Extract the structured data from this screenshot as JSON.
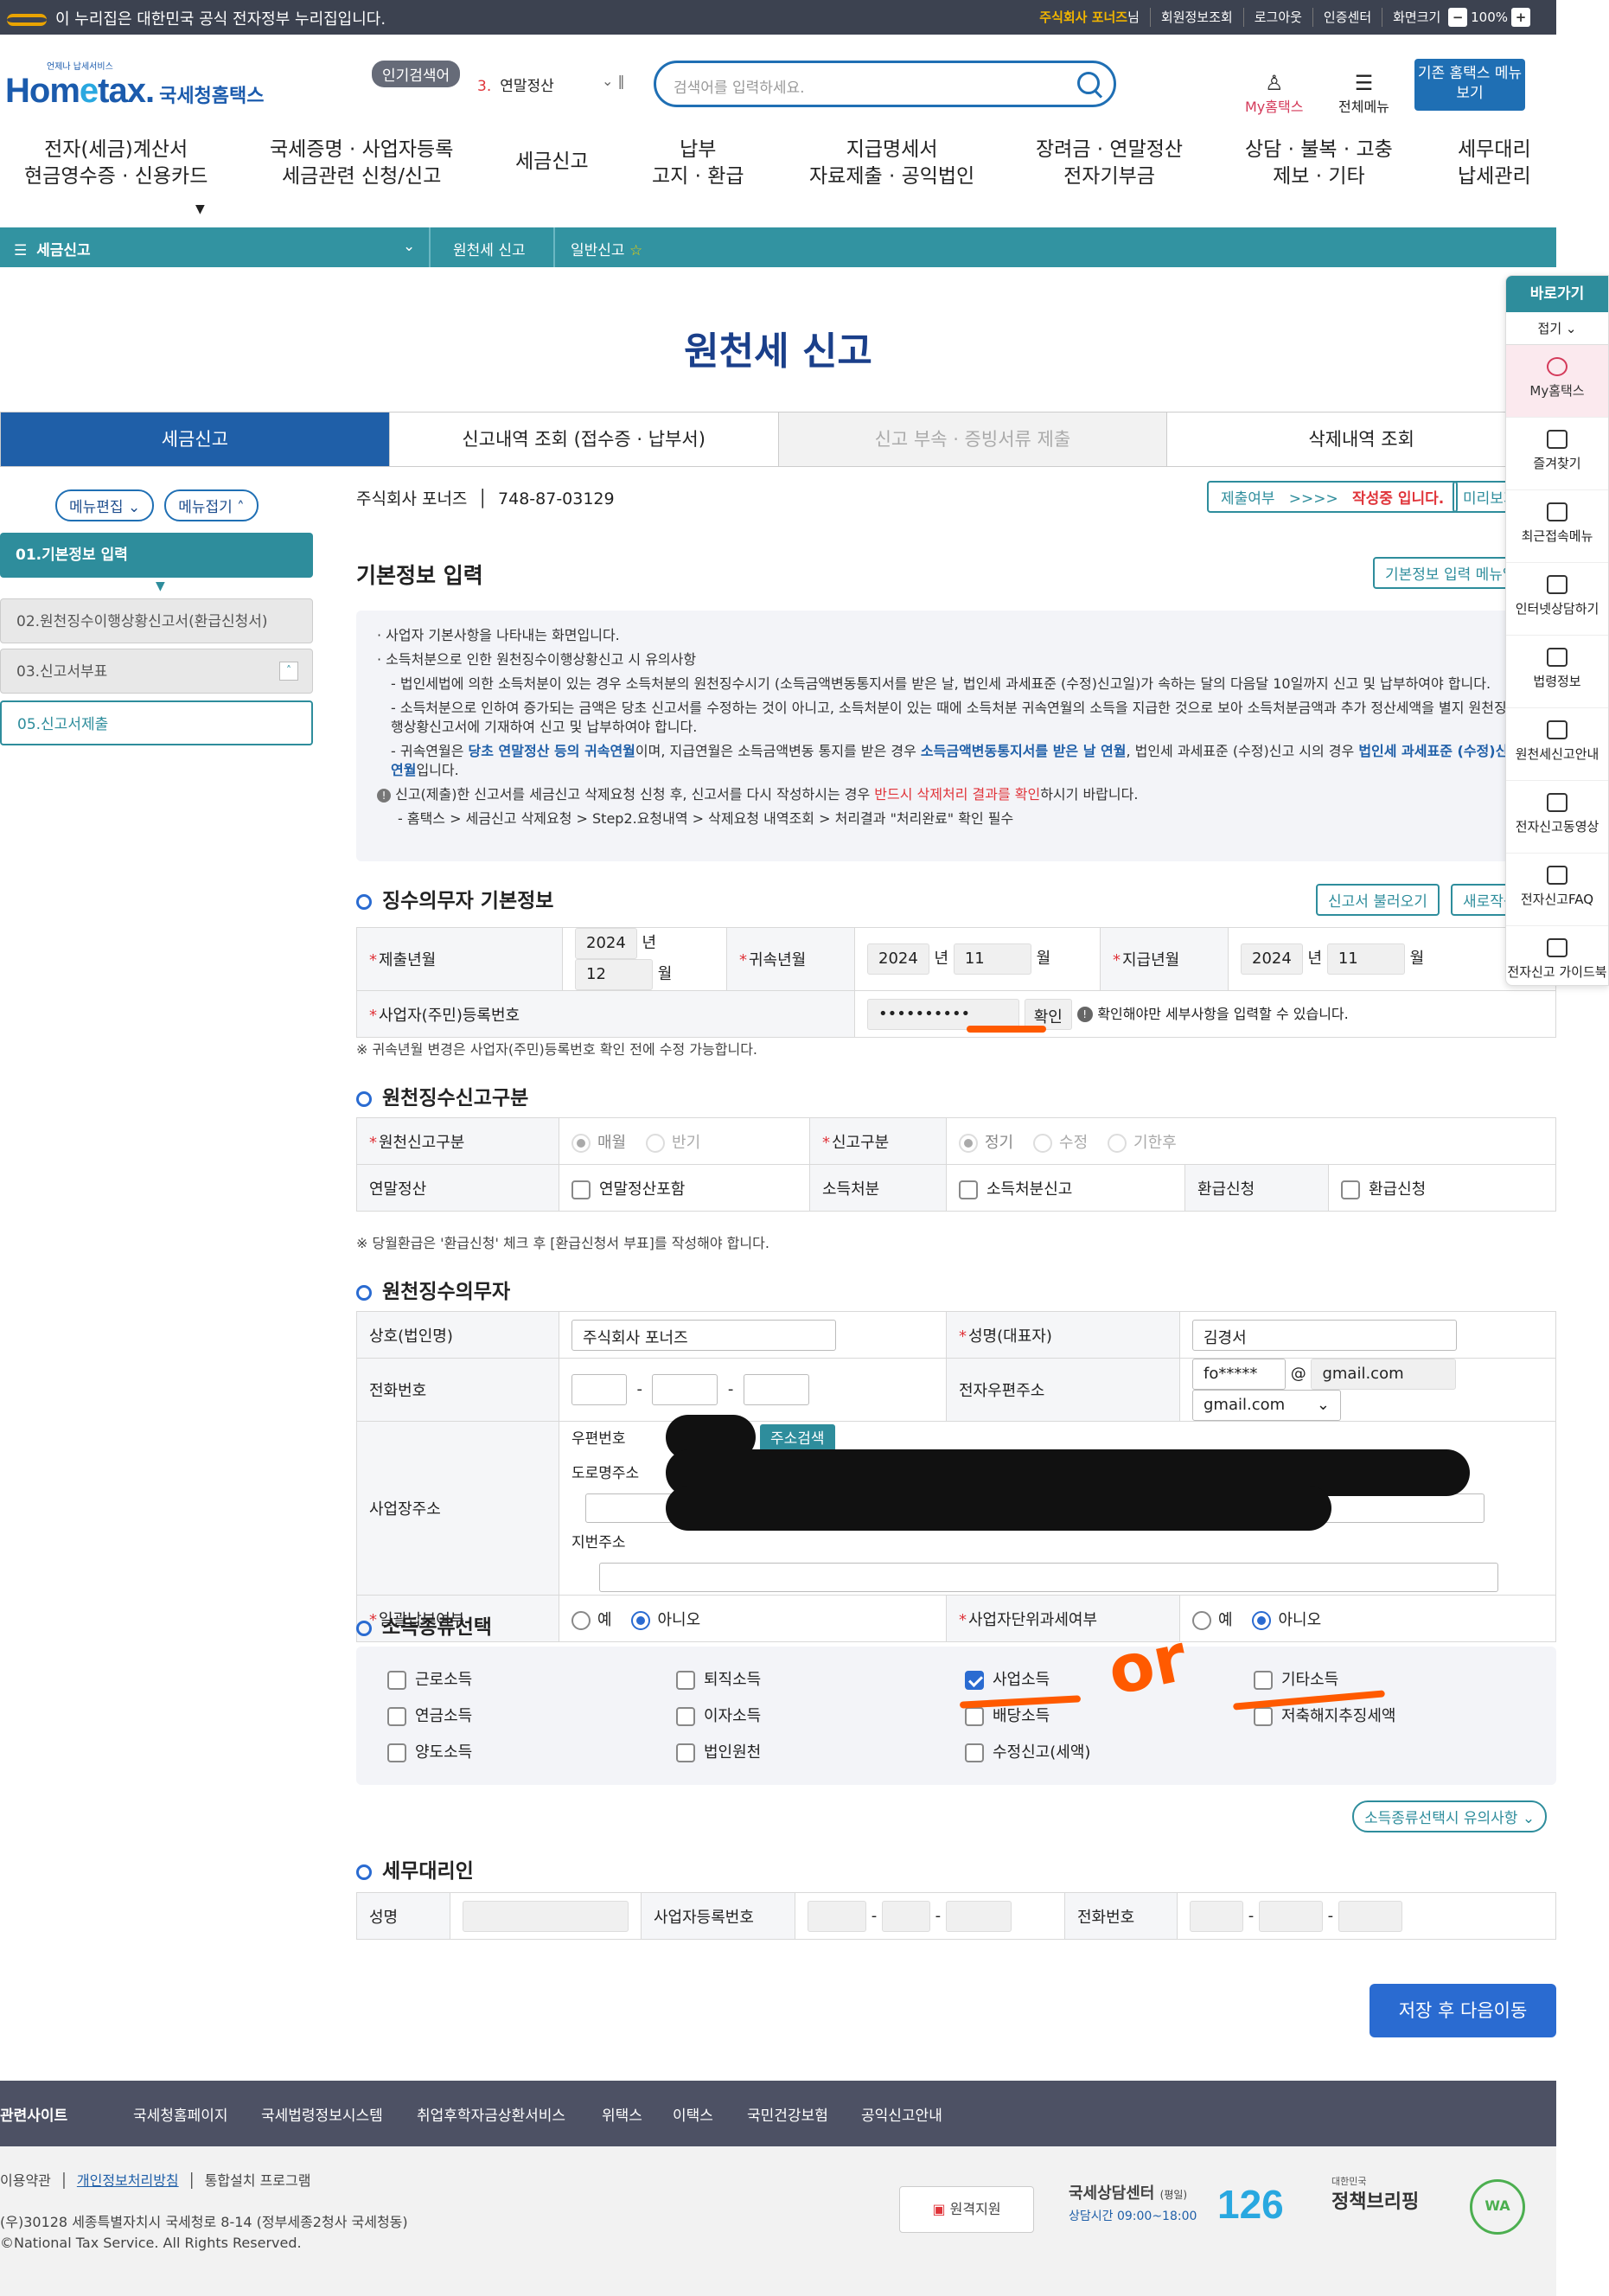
{
  "topbar": {
    "gov_notice": "이 누리집은 대한민국 공식 전자정부 누리집입니다.",
    "company": "주식회사 포너즈",
    "company_suffix": "님",
    "links": [
      "회원정보조회",
      "로그아웃",
      "인증센터",
      "화면크기"
    ],
    "zoom": "100%"
  },
  "header": {
    "logo_main": "Hom",
    "logo_e": "e",
    "logo_tax": "tax.",
    "logo_name": "국세청홈택스",
    "logo_tag": "언제나 납세서비스",
    "popular_label": "인기검색어",
    "popular_num": "3.",
    "popular_text": "연말정산",
    "search_placeholder": "검색어를 입력하세요.",
    "my_hometax": "My홈택스",
    "all_menu": "전체메뉴",
    "old_hometax": "기존 홈택스 메뉴 보기"
  },
  "gnb": [
    {
      "l1": "전자(세금)계산서",
      "l2": "현금영수증 · 신용카드"
    },
    {
      "l1": "국세증명 · 사업자등록",
      "l2": "세금관련 신청/신고"
    },
    {
      "l1": "세금신고",
      "l2": ""
    },
    {
      "l1": "납부",
      "l2": "고지 · 환급"
    },
    {
      "l1": "지급명세서",
      "l2": "자료제출 · 공익법인"
    },
    {
      "l1": "장려금 · 연말정산",
      "l2": "전자기부금"
    },
    {
      "l1": "상담 · 불복 · 고충",
      "l2": "제보 · 기타"
    },
    {
      "l1": "세무대리",
      "l2": "납세관리"
    }
  ],
  "breadcrumb": {
    "menu": "세금신고",
    "level2": "원천세 신고",
    "level3": "일반신고"
  },
  "page_title": "원천세 신고",
  "tabs": [
    "세금신고",
    "신고내역 조회 (접수증 · 납부서)",
    "신고 부속 · 증빙서류 제출",
    "삭제내역 조회"
  ],
  "sidebar": {
    "edit": "메뉴편집",
    "fold": "메뉴접기",
    "items": [
      "01.기본정보 입력",
      "02.원천징수이행상황신고서(환급신청서)",
      "03.신고서부표",
      "05.신고서제출"
    ]
  },
  "biz": {
    "name": "주식회사 포너즈",
    "number": "748-87-03129",
    "status_label": "제출여부",
    "status_arrows": ">>>>",
    "status_value": "작성중 입니다.",
    "preview": "미리보기"
  },
  "basic": {
    "title": "기본정보 입력",
    "help_btn": "기본정보 입력 메뉴얼"
  },
  "notice": {
    "l1": "사업자 기본사항을 나타내는 화면입니다.",
    "l2": "소득처분으로 인한 원천징수이행상황신고 시 유의사항",
    "l3": "법인세법에 의한 소득처분이 있는 경우 소득처분의 원천징수시기 (소득금액변동통지서를 받은 날, 법인세 과세표준 (수정)신고일)가 속하는 달의 다음달 10일까지 신고 및 납부하여야 합니다.",
    "l4": "소득처분으로 인하여 증가되는 금액은 당초 신고서를 수정하는 것이 아니고, 소득처분이 있는 때에 소득처분 귀속연월의 소득을 지급한 것으로 보아 소득처분금액과 추가 정산세액을 별지 원천징수이행상황신고서에 기재하여 신고 및 납부하여야 합니다.",
    "l5a": "귀속연월은 ",
    "l5b": "당초 연말정산 등의 귀속연월",
    "l5c": "이며, 지급연월은 소득금액변동 통지를 받은 경우 ",
    "l5d": "소득금액변동통지서를 받은 날 연월",
    "l5e": ", 법인세 과세표준 (수정)신고 시의 경우 ",
    "l5f": "법인세 과세표준 (수정)신고일 연월",
    "l5g": "입니다.",
    "l6a": "신고(제출)한 신고서를 세금신고 삭제요청 신청 후, 신고서를 다시 작성하시는 경우 ",
    "l6b": "반드시 삭제처리 결과를 확인",
    "l6c": "하시기 바랍니다.",
    "l7": "- 홈택스 > 세금신고 삭제요청 > Step2.요청내역 > 삭제요청 내역조회 > 처리결과 \"처리완료\" 확인 필수"
  },
  "withholder_basic": {
    "title": "징수의무자 기본정보",
    "load_btn": "신고서 불러오기",
    "new_btn": "새로작성",
    "submit_ym": "제출년월",
    "belong_ym": "귀속년월",
    "pay_ym": "지급년월",
    "submit_year": "2024",
    "submit_month": "12",
    "belong_year": "2024",
    "belong_month": "11",
    "pay_year": "2024",
    "pay_month": "11",
    "year_unit": "년",
    "month_unit": "월",
    "reg_label": "사업자(주민)등록번호",
    "reg_value": "••••••••••",
    "confirm_btn": "확인",
    "confirm_note": "확인해야만 세부사항을 입력할 수 있습니다.",
    "note": "※ 귀속년월 변경은 사업자(주민)등록번호 확인 전에 수정 가능합니다."
  },
  "report_type": {
    "title": "원천징수신고구분",
    "r1": "원천신고구분",
    "r1_opt1": "매월",
    "r1_opt2": "반기",
    "r2": "신고구분",
    "r2_opt1": "정기",
    "r2_opt2": "수정",
    "r2_opt3": "기한후",
    "c1": "연말정산",
    "c1_opt": "연말정산포함",
    "c2": "소득처분",
    "c2_opt": "소득처분신고",
    "c3": "환급신청",
    "c3_opt": "환급신청",
    "note": "※ 당월환급은 '환급신청' 체크 후 [환급신청서 부표]를 작성해야 합니다."
  },
  "withholder": {
    "title": "원천징수의무자",
    "name_label": "상호(법인명)",
    "name_value": "주식회사 포너즈",
    "rep_label": "성명(대표자)",
    "rep_value": "김경서",
    "phone_label": "전화번호",
    "email_label": "전자우편주소",
    "email_id": "fo*****",
    "email_at": "@",
    "email_domain": "gmail.com",
    "email_select": "gmail.com",
    "addr_label": "사업장주소",
    "zip_label": "우편번호",
    "addr_search": "주소검색",
    "road_label": "도로명주소",
    "lot_label": "지번주소",
    "bulk_label": "일괄납부여부",
    "unit_label": "사업자단위과세여부",
    "yes": "예",
    "no": "아니오"
  },
  "income": {
    "title": "소득종류선택",
    "items": [
      "근로소득",
      "퇴직소득",
      "사업소득",
      "기타소득",
      "연금소득",
      "이자소득",
      "배당소득",
      "저축해지추징세액",
      "양도소득",
      "법인원천",
      "수정신고(세액)"
    ],
    "caution_btn": "소득종류선택시 유의사항",
    "annotation": "or"
  },
  "agent": {
    "title": "세무대리인",
    "name": "성명",
    "biz_no": "사업자등록번호",
    "phone": "전화번호"
  },
  "save_btn": "저장 후 다음이동",
  "footer": {
    "related": "관련사이트",
    "links": [
      "국세청홈페이지",
      "국세법령정보시스템",
      "취업후학자금상환서비스",
      "위택스",
      "이택스",
      "국민건강보험",
      "공익신고안내"
    ],
    "terms": "이용약관",
    "privacy": "개인정보처리방침",
    "install": "통합설치 프로그램",
    "address": "(우)30128 세종특별자치시 국세청로 8-14 (정부세종2청사 국세청동)",
    "copyright": "©National Tax Service. All Rights Reserved.",
    "remote": "원격지원",
    "center": "국세상담센터",
    "center_sub": "(평일)",
    "hours_label": "상담시간",
    "hours": "09:00~18:00",
    "center_no": "126",
    "policy_small": "대한민국",
    "policy": "정책브리핑",
    "wa": "WA"
  },
  "quick": {
    "title": "바로가기",
    "fold": "접기",
    "items": [
      "My홈택스",
      "즐겨찾기",
      "최근접속메뉴",
      "인터넷상담하기",
      "법령정보",
      "원천세신고안내",
      "전자신고동영상",
      "전자신고FAQ",
      "전자신고 가이드북"
    ]
  }
}
